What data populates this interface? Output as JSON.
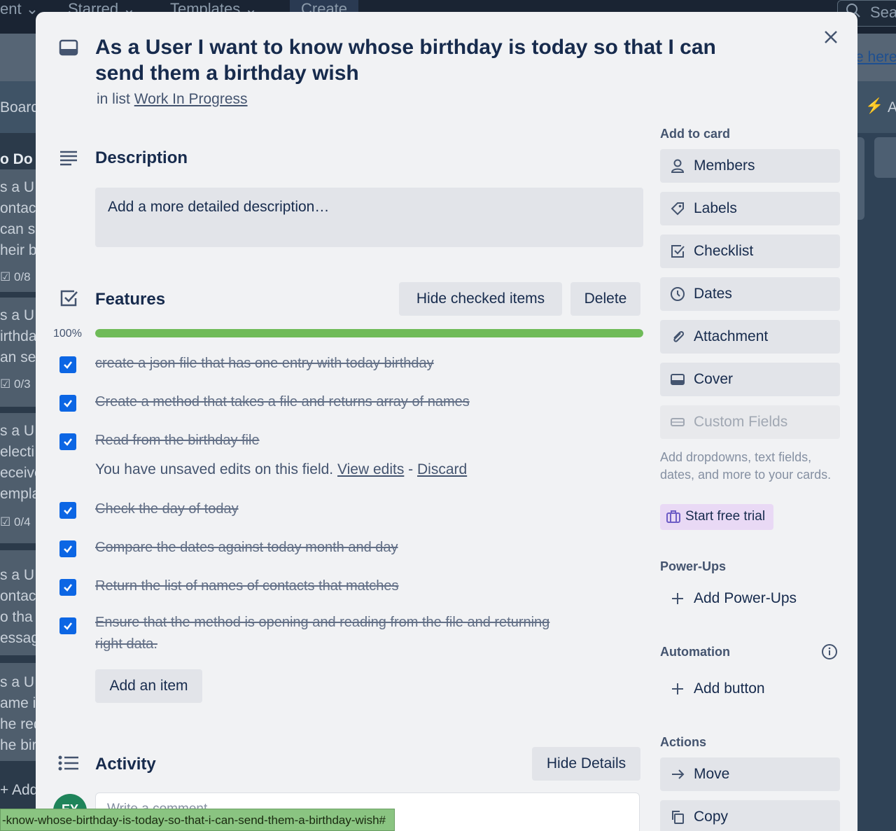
{
  "topnav": {
    "items": [
      "ent",
      "Starred",
      "Templates"
    ],
    "create_label": "Create",
    "search_text": "Sea",
    "link_text": "e here"
  },
  "background": {
    "board_text": "Board",
    "list_title": "o Do",
    "cards": [
      {
        "lines": [
          "s a U",
          "ontac",
          "can s",
          "heir b"
        ],
        "badge": "0/8"
      },
      {
        "lines": [
          "s a U",
          "irthda",
          "an se"
        ],
        "badge": "0/3"
      },
      {
        "lines": [
          "s a U",
          "electi",
          "eceive",
          "empla"
        ],
        "badge": "0/4"
      },
      {
        "lines": [
          "s a U",
          "ontac",
          "o tha",
          "essag"
        ]
      },
      {
        "lines": [
          "s a U",
          "ame i",
          "he red",
          "he bir"
        ]
      }
    ],
    "add_card": "+ Add"
  },
  "card": {
    "title": "As a User I want to know whose birthday is today so that I can send them a birthday wish",
    "in_list_prefix": "in list",
    "list_name": "Work In Progress"
  },
  "description": {
    "heading": "Description",
    "placeholder": "Add a more detailed description…"
  },
  "checklist": {
    "heading": "Features",
    "hide_checked_label": "Hide checked items",
    "delete_label": "Delete",
    "progress_text": "100%",
    "progress": 1.0,
    "items": [
      "create a json file that has one entry with today birthday",
      "Create a method that takes a file and returns array of names",
      "Read from the birthday file",
      "Check the day of today",
      "Compare the dates against today month and day",
      "Return the list of names of contacts that matches",
      "Ensure that the method is opening and reading from the file and returning right data."
    ],
    "unsaved_text": "You have unsaved edits on this field.",
    "view_edits": "View edits",
    "separator": "-",
    "discard": "Discard",
    "add_item_label": "Add an item"
  },
  "activity": {
    "heading": "Activity",
    "hide_details_label": "Hide Details",
    "avatar_initials": "EY",
    "comment_placeholder": "Write a comment…"
  },
  "sidebar": {
    "add_to_card_heading": "Add to card",
    "buttons": [
      {
        "label": "Members",
        "icon": "person-icon"
      },
      {
        "label": "Labels",
        "icon": "tag-icon"
      },
      {
        "label": "Checklist",
        "icon": "checkbox-icon"
      },
      {
        "label": "Dates",
        "icon": "clock-icon"
      },
      {
        "label": "Attachment",
        "icon": "paperclip-icon"
      },
      {
        "label": "Cover",
        "icon": "card-icon"
      },
      {
        "label": "Custom Fields",
        "icon": "field-icon"
      }
    ],
    "custom_fields_promo": "Add dropdowns, text fields, dates, and more to your cards.",
    "start_trial_label": "Start free trial",
    "powerups_heading": "Power-Ups",
    "add_powerups_label": "Add Power-Ups",
    "automation_heading": "Automation",
    "add_button_label": "Add button",
    "actions_heading": "Actions",
    "move_label": "Move",
    "copy_label": "Copy"
  },
  "status_bar": {
    "url_text": "-know-whose-birthday-is-today-so-that-i-can-send-them-a-birthday-wish#"
  },
  "colors": {
    "checkbox": "#0c66e4",
    "progress_fill": "#6fbb58",
    "trial_bg": "#e9d9f5",
    "avatar_bg": "#1f845a"
  }
}
